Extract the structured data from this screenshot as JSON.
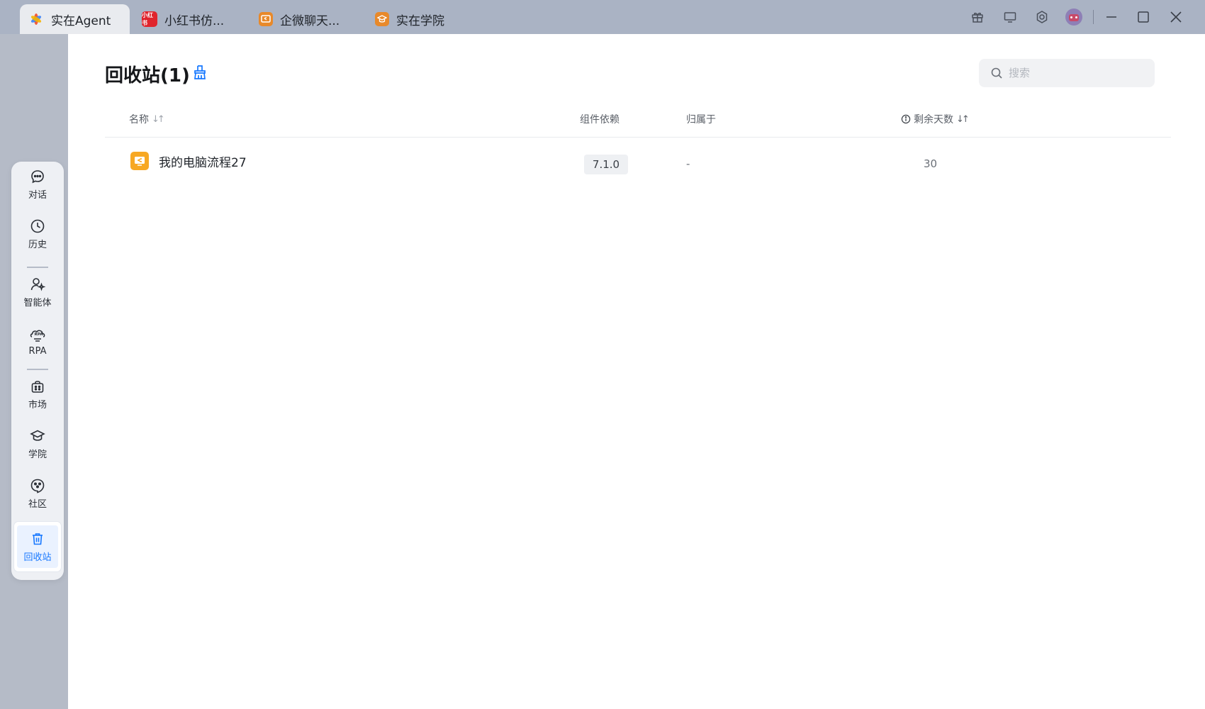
{
  "tabs": [
    {
      "label": "实在Agent",
      "icon": "agent-logo-icon",
      "active": true
    },
    {
      "label": "小红书仿...",
      "icon": "xiaohongshu-icon",
      "icon_text": "小红书",
      "active": false
    },
    {
      "label": "企微聊天...",
      "icon": "workflow-icon",
      "active": false
    },
    {
      "label": "实在学院",
      "icon": "academy-icon",
      "active": false
    }
  ],
  "window_controls": [
    "gift-icon",
    "monitor-icon",
    "settings-icon",
    "avatar",
    "minimize-icon",
    "maximize-icon",
    "close-icon"
  ],
  "sidebar": {
    "items": [
      {
        "label": "对话",
        "icon": "chat-icon"
      },
      {
        "label": "历史",
        "icon": "clock-icon"
      },
      {
        "label": "智能体",
        "icon": "agent-person-icon"
      },
      {
        "label": "RPA",
        "icon": "rpa-icon",
        "icon_text": "RPA"
      },
      {
        "label": "市场",
        "icon": "market-bag-icon"
      },
      {
        "label": "学院",
        "icon": "graduation-cap-icon"
      },
      {
        "label": "社区",
        "icon": "community-icon"
      },
      {
        "label": "回收站",
        "icon": "trash-icon",
        "selected": true
      }
    ]
  },
  "page": {
    "title": "回收站(1)",
    "search_placeholder": "搜索"
  },
  "table": {
    "columns": {
      "name": "名称",
      "dependency": "组件依赖",
      "owner": "归属于",
      "days_left": "剩余天数"
    },
    "rows": [
      {
        "name": "我的电脑流程27",
        "dependency": "7.1.0",
        "owner": "-",
        "days_left": "30"
      }
    ]
  },
  "colors": {
    "accent": "#1677ff",
    "file_icon": "#f7a823",
    "xiaohongshu": "#e0242c",
    "orange_tab": "#e8892a"
  }
}
